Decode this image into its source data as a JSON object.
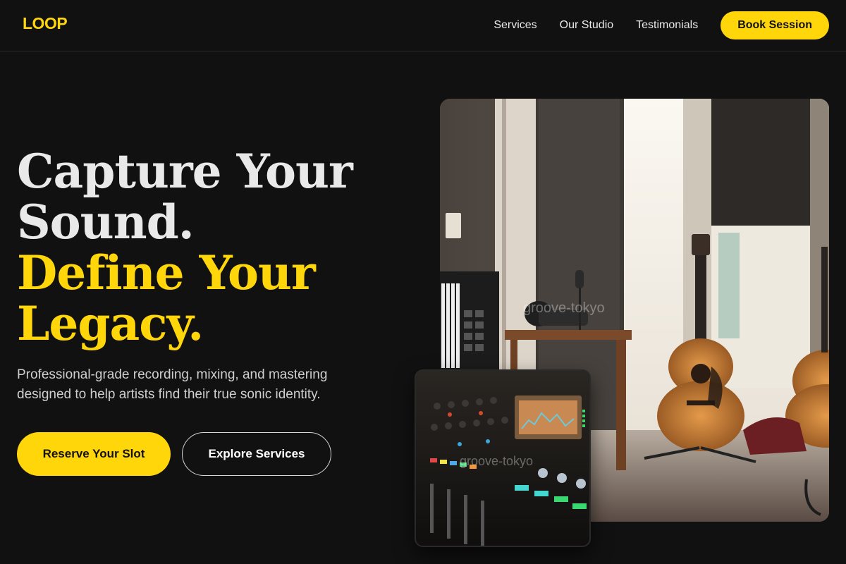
{
  "brand": {
    "logo": "LOOP",
    "accent": "#FFD60A"
  },
  "nav": {
    "items": [
      "Services",
      "Our Studio",
      "Testimonials"
    ],
    "cta": "Book Session"
  },
  "hero": {
    "title_line1": "Capture Your",
    "title_line2": "Sound.",
    "title_line3": "Define Your",
    "title_line4": "Legacy.",
    "subtitle": "Professional-grade recording, mixing, and mastering designed to help artists find their true sonic identity.",
    "primary_cta": "Reserve Your Slot",
    "secondary_cta": "Explore Services"
  },
  "images": {
    "studio_watermark": "groove-tokyo",
    "mixer_watermark": "groove-tokyo"
  }
}
